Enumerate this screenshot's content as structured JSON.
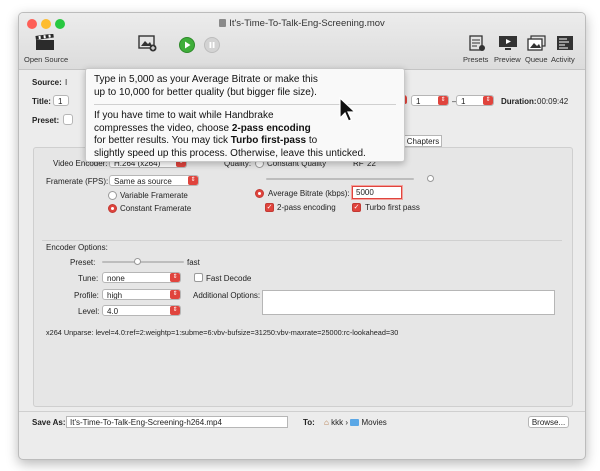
{
  "window": {
    "title": "It's-Time-To-Talk-Eng-Screening.mov"
  },
  "toolbar": {
    "open_source": "Open Source",
    "presets": "Presets",
    "preview": "Preview",
    "queue": "Queue",
    "activity": "Activity"
  },
  "source": {
    "label": "Source:",
    "value": "I"
  },
  "title_row": {
    "label": "Title:",
    "value": "1",
    "range_type": "rs",
    "range_from": "1",
    "range_sep": "–",
    "range_to": "1",
    "duration_label": "Duration:",
    "duration_value": "00:09:42"
  },
  "preset": {
    "label": "Preset:"
  },
  "tabs": {
    "subtitles_fragment": "es",
    "chapters": "Chapters"
  },
  "tooltip": {
    "para1_line1": "Type in 5,000 as your Average Bitrate or make this",
    "para1_line2": "up to 10,000 for better quality (but bigger file size).",
    "para2_line1": "If you have time to wait while Handbrake",
    "para2_line2_a": "compresses the video, choose ",
    "para2_line2_b": "2-pass encoding",
    "para2_line3": "for better results. You may tick ",
    "para2_line3_b": "Turbo first-pass",
    "para2_line3_c": " to",
    "para2_line4": "slightly speed up this process. Otherwise, leave this unticked."
  },
  "video": {
    "encoder_label": "Video Encoder:",
    "encoder_value": "H.264 (x264)",
    "framerate_label": "Framerate (FPS):",
    "framerate_value": "Same as source",
    "variable_framerate": "Variable Framerate",
    "constant_framerate": "Constant Framerate",
    "framerate_mode_selected": "Constant Framerate"
  },
  "quality": {
    "label": "Quality:",
    "constant_quality": "Constant Quality",
    "rf_label": "RF",
    "rf_value": "22",
    "avg_bitrate": "Average Bitrate (kbps):",
    "bitrate_value": "5000",
    "mode_selected": "Average Bitrate (kbps):",
    "two_pass": "2-pass encoding",
    "two_pass_checked": true,
    "turbo": "Turbo first pass",
    "turbo_checked": true
  },
  "encoder_options": {
    "title": "Encoder Options:",
    "preset_label": "Preset:",
    "preset_value": "fast",
    "tune_label": "Tune:",
    "tune_value": "none",
    "fast_decode": "Fast Decode",
    "fast_decode_checked": false,
    "profile_label": "Profile:",
    "profile_value": "high",
    "additional_label": "Additional Options:",
    "additional_value": "",
    "level_label": "Level:",
    "level_value": "4.0",
    "unparse": "x264 Unparse: level=4.0:ref=2:weightp=1:subme=6:vbv-bufsize=31250:vbv-maxrate=25000:rc-lookahead=30"
  },
  "save": {
    "label": "Save As:",
    "value": "It's-Time-To-Talk-Eng-Screening-h264.mp4",
    "to_label": "To:",
    "path_user": "kkk",
    "path_sep": "›",
    "path_folder": "Movies",
    "browse": "Browse..."
  },
  "colors": {
    "accent": "#e0443d",
    "close": "#fe5f57",
    "minimize": "#febc2e",
    "zoom": "#28c840",
    "start": "#3fae3a"
  },
  "icons": {
    "open_source": "film-clapper-icon",
    "add_queue": "picture-add-icon",
    "start": "play-icon",
    "pause": "pause-icon",
    "presets": "presets-icon",
    "preview": "preview-icon",
    "queue": "queue-icon",
    "activity": "activity-icon",
    "cursor": "mouse-pointer-icon"
  }
}
